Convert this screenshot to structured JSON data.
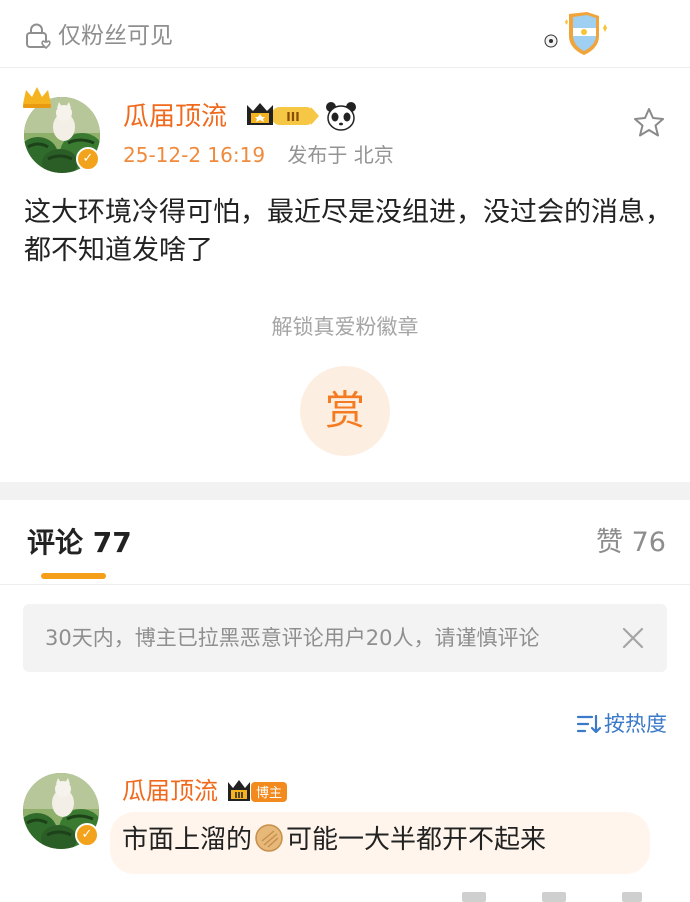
{
  "visibility": {
    "label": "仅粉丝可见"
  },
  "post": {
    "author": "瓜届顶流",
    "rank_level": "III",
    "timestamp": "25-12-2 16:19",
    "location": "发布于 北京",
    "text": "这大环境冷得可怕，最近尽是没组进，没过会的消息，都不知道发啥了",
    "unlock_label": "解锁真爱粉徽章",
    "reward_label": "赏"
  },
  "tabs": {
    "comments_label": "评论 77",
    "likes_label": "赞 76"
  },
  "notice": {
    "text": "30天内，博主已拉黑恶意评论用户20人，请谨慎评论"
  },
  "sort": {
    "label": "按热度"
  },
  "comment": {
    "author": "瓜届顶流",
    "badge_label": "博主",
    "text_before": "市面上溜的",
    "text_after": "可能一大半都开不起来"
  },
  "colors": {
    "accent": "#f06a1d",
    "link": "#3b79c9",
    "tab_indicator": "#f59f18"
  }
}
